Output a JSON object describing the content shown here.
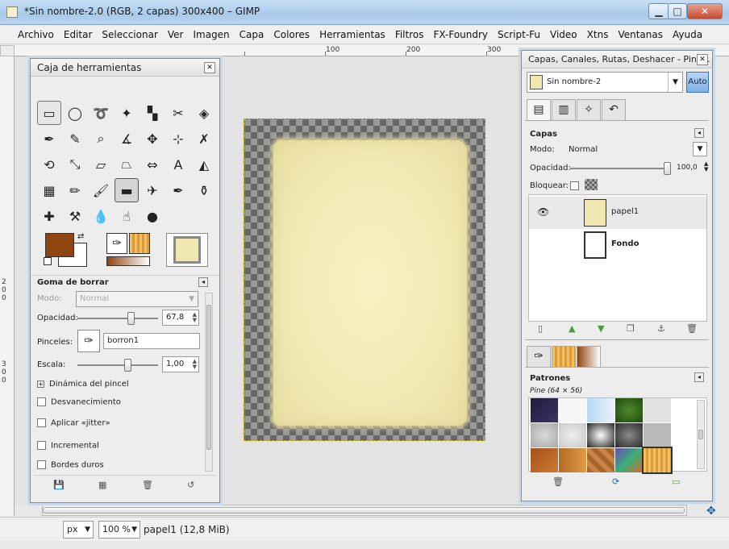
{
  "window": {
    "title": "*Sin nombre-2.0 (RGB, 2 capas) 300x400 – GIMP",
    "minimize": "▁",
    "maximize": "□",
    "close": "✕"
  },
  "menu": [
    {
      "label": "Archivo"
    },
    {
      "label": "Editar"
    },
    {
      "label": "Seleccionar"
    },
    {
      "label": "Ver"
    },
    {
      "label": "Imagen"
    },
    {
      "label": "Capa"
    },
    {
      "label": "Colores"
    },
    {
      "label": "Herramientas"
    },
    {
      "label": "Filtros"
    },
    {
      "label": "FX-Foundry"
    },
    {
      "label": "Script-Fu"
    },
    {
      "label": "Video"
    },
    {
      "label": "Xtns"
    },
    {
      "label": "Ventanas"
    },
    {
      "label": "Ayuda"
    }
  ],
  "rulers": {
    "h_ticks": [
      "100",
      "200",
      "300"
    ],
    "v_ticks": [
      "2",
      "0",
      "0",
      "3",
      "0",
      "0"
    ]
  },
  "toolbox": {
    "title": "Caja de herramientas",
    "tools": [
      {
        "name": "rect-select-icon",
        "glyph": "▭"
      },
      {
        "name": "ellipse-select-icon",
        "glyph": "◯"
      },
      {
        "name": "free-select-icon",
        "glyph": "➰"
      },
      {
        "name": "fuzzy-select-icon",
        "glyph": "✦"
      },
      {
        "name": "color-select-icon",
        "glyph": "▚"
      },
      {
        "name": "scissors-icon",
        "glyph": "✂"
      },
      {
        "name": "foreground-select-icon",
        "glyph": "◈"
      },
      {
        "name": "paths-icon",
        "glyph": "✒"
      },
      {
        "name": "color-picker-icon",
        "glyph": "✎"
      },
      {
        "name": "zoom-icon",
        "glyph": "⌕"
      },
      {
        "name": "measure-icon",
        "glyph": "∡"
      },
      {
        "name": "move-icon",
        "glyph": "✥"
      },
      {
        "name": "align-icon",
        "glyph": "⊹"
      },
      {
        "name": "crop-icon",
        "glyph": "✗"
      },
      {
        "name": "rotate-icon",
        "glyph": "⟲"
      },
      {
        "name": "scale-icon",
        "glyph": "⤡"
      },
      {
        "name": "shear-icon",
        "glyph": "▱"
      },
      {
        "name": "perspective-icon",
        "glyph": "⏢"
      },
      {
        "name": "flip-icon",
        "glyph": "⇔"
      },
      {
        "name": "text-icon",
        "glyph": "A"
      },
      {
        "name": "bucket-fill-icon",
        "glyph": "◭"
      },
      {
        "name": "blend-icon",
        "glyph": "▦"
      },
      {
        "name": "pencil-icon",
        "glyph": "✏"
      },
      {
        "name": "paintbrush-icon",
        "glyph": "🖌"
      },
      {
        "name": "eraser-icon",
        "glyph": "▬"
      },
      {
        "name": "airbrush-icon",
        "glyph": "✈"
      },
      {
        "name": "ink-icon",
        "glyph": "✒"
      },
      {
        "name": "clone-icon",
        "glyph": "⚱"
      },
      {
        "name": "heal-icon",
        "glyph": "✚"
      },
      {
        "name": "perspective-clone-icon",
        "glyph": "⚒"
      },
      {
        "name": "blur-icon",
        "glyph": "💧"
      },
      {
        "name": "smudge-icon",
        "glyph": "☝"
      },
      {
        "name": "dodge-burn-icon",
        "glyph": "●"
      }
    ],
    "active_tool_index": 24,
    "fg_color": "#8f4512",
    "bg_color": "#ffffff"
  },
  "tool_options": {
    "title": "Goma de borrar",
    "mode_label": "Modo:",
    "mode_value": "Normal",
    "opacity_label": "Opacidad:",
    "opacity_value": "67,8",
    "opacity": 67.8,
    "brush_label": "Pinceles:",
    "brush_value": "borron1",
    "scale_label": "Escala:",
    "scale_value": "1,00",
    "dynamics_label": "Dinámica del pincel",
    "options": [
      {
        "label": "Desvanecimiento"
      },
      {
        "label": "Aplicar «jitter»"
      },
      {
        "label": "Incremental"
      },
      {
        "label": "Bordes duros"
      }
    ]
  },
  "layers_dock": {
    "title": "Capas, Canales, Rutas, Deshacer - Pinc...",
    "image_name": "Sin nombre-2",
    "auto_label": "Auto",
    "section": "Capas",
    "mode_label": "Modo:",
    "mode_value": "Normal",
    "opacity_label": "Opacidad:",
    "opacity_value": "100,0",
    "lock_label": "Bloquear:",
    "layers": [
      {
        "name": "papel1"
      },
      {
        "name": "Fondo"
      }
    ]
  },
  "patterns_dock": {
    "title": "Patrones",
    "pattern_info": "Pine (64 × 56)"
  },
  "status": {
    "unit": "px",
    "zoom": "100 %",
    "info": "papel1 (12,8 MiB)"
  },
  "colors": {
    "accent": "#6fa4dc",
    "parchment": "#f4ebb8"
  }
}
